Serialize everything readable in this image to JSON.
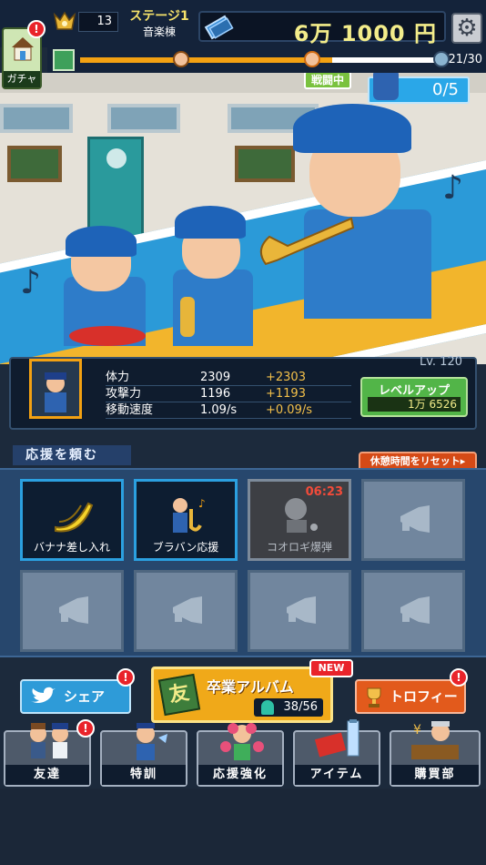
{
  "hud": {
    "gacha_label": "ガチャ",
    "gacha_badge": "!",
    "rank_value": "13",
    "stage_name": "ステージ1",
    "stage_sub": "音楽棟",
    "money": "6万 1000 円",
    "progress_count": "21/30",
    "progress_fraction": 0.7
  },
  "scene": {
    "battle_label": "戦闘中",
    "enemy_count": "0/5"
  },
  "stats": {
    "level": "Lv. 120",
    "rows": [
      {
        "key": "体力",
        "value": "2309",
        "delta": "+2303"
      },
      {
        "key": "攻撃力",
        "value": "1196",
        "delta": "+1193"
      },
      {
        "key": "移動速度",
        "value": "1.09/s",
        "delta": "+0.09/s"
      }
    ],
    "levelup_label": "レベルアップ",
    "levelup_cost": "1万 6526"
  },
  "support": {
    "title": "応援を頼む",
    "reset_label": "休憩時間をリセット▸",
    "slots": [
      {
        "label": "バナナ差し入れ",
        "state": "active",
        "icon": "banana-icon"
      },
      {
        "label": "ブラバン応援",
        "state": "active",
        "icon": "brass-band-icon"
      },
      {
        "label": "コオロギ爆弾",
        "state": "cooldown",
        "timer": "06:23",
        "icon": "cricket-bomb-icon"
      },
      {
        "label": "",
        "state": "empty",
        "icon": "megaphone-icon"
      },
      {
        "label": "",
        "state": "empty",
        "icon": "megaphone-icon"
      },
      {
        "label": "",
        "state": "empty",
        "icon": "megaphone-icon"
      },
      {
        "label": "",
        "state": "empty",
        "icon": "megaphone-icon"
      },
      {
        "label": "",
        "state": "empty",
        "icon": "megaphone-icon"
      }
    ]
  },
  "bottom": {
    "share_label": "シェア",
    "album_label": "卒業アルバム",
    "album_book": "友",
    "album_count": "38/56",
    "new_badge": "NEW",
    "trophy_label": "トロフィー",
    "badge": "!",
    "nav": [
      {
        "label": "友達"
      },
      {
        "label": "特訓"
      },
      {
        "label": "応援強化"
      },
      {
        "label": "アイテム"
      },
      {
        "label": "購買部"
      }
    ]
  }
}
